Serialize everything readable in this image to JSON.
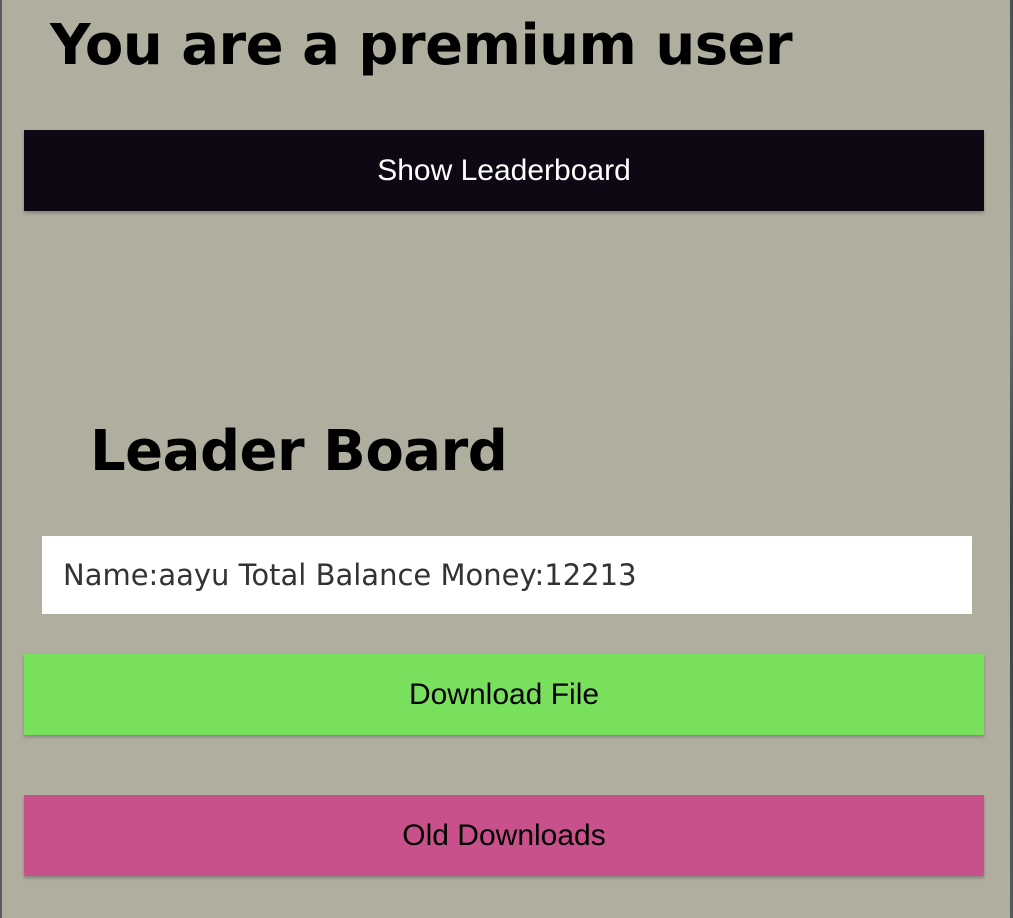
{
  "header": {
    "title": "You are a premium user"
  },
  "leaderboard_button": {
    "label": "Show Leaderboard"
  },
  "leaderboard": {
    "title": "Leader Board",
    "entries": [
      {
        "text": "Name:aayu Total Balance Money:12213"
      }
    ]
  },
  "actions": {
    "download_label": "Download File",
    "old_downloads_label": "Old Downloads"
  },
  "colors": {
    "background": "#b0ae9f",
    "leaderboard_button": "#0d0814",
    "download_button": "#78e05d",
    "old_downloads_button": "#c8508b"
  }
}
